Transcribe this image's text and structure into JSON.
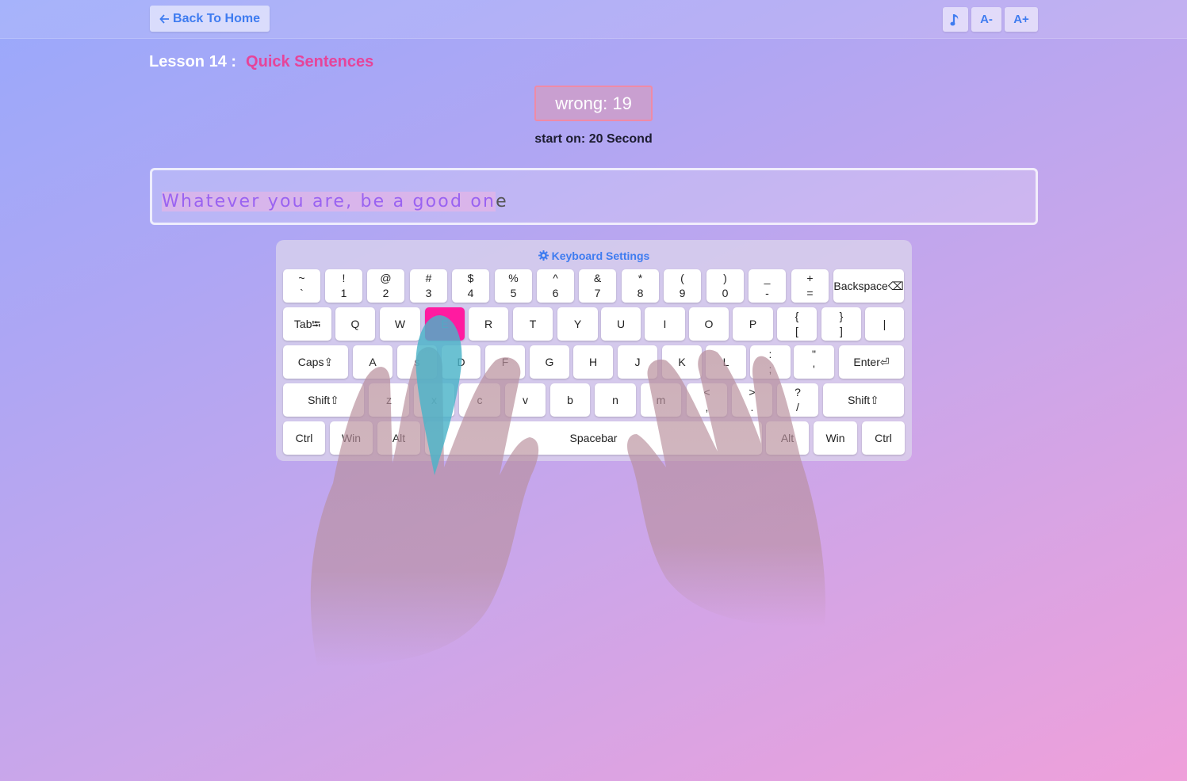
{
  "header": {
    "back_label": "Back To Home",
    "music_icon": "music-note-icon",
    "font_decrease_label": "A-",
    "font_increase_label": "A+"
  },
  "lesson": {
    "number_label": "Lesson 14 :",
    "title": "Quick Sentences"
  },
  "stats": {
    "wrong_label": "wrong: 19",
    "start_label": "start on: 20 Second"
  },
  "typing": {
    "typed": "Whatever you are, be a good on",
    "remaining": "e"
  },
  "keyboard": {
    "settings_label": "Keyboard Settings",
    "active_key": "E",
    "rows": [
      [
        [
          "~",
          "`"
        ],
        [
          "!",
          "1"
        ],
        [
          "@",
          "2"
        ],
        [
          "#",
          "3"
        ],
        [
          "$",
          "4"
        ],
        [
          "%",
          "5"
        ],
        [
          "^",
          "6"
        ],
        [
          "&",
          "7"
        ],
        [
          "*",
          "8"
        ],
        [
          "(",
          "9"
        ],
        [
          ")",
          "0"
        ],
        [
          "_",
          "-"
        ],
        [
          "+",
          "="
        ],
        [
          "Backspace⌫"
        ]
      ],
      [
        [
          "Tab⭾"
        ],
        [
          "Q"
        ],
        [
          "W"
        ],
        [
          "E"
        ],
        [
          "R"
        ],
        [
          "T"
        ],
        [
          "Y"
        ],
        [
          "U"
        ],
        [
          "I"
        ],
        [
          "O"
        ],
        [
          "P"
        ],
        [
          "{",
          "["
        ],
        [
          "}",
          "]"
        ],
        [
          "|"
        ]
      ],
      [
        [
          "Caps⇪"
        ],
        [
          "A"
        ],
        [
          "s"
        ],
        [
          "D"
        ],
        [
          "F"
        ],
        [
          "G"
        ],
        [
          "H"
        ],
        [
          "J"
        ],
        [
          "K"
        ],
        [
          "L"
        ],
        [
          ":",
          ";"
        ],
        [
          "\"",
          "'"
        ],
        [
          "Enter⏎"
        ]
      ],
      [
        [
          "Shift⇧"
        ],
        [
          "z"
        ],
        [
          "x"
        ],
        [
          "c"
        ],
        [
          "v"
        ],
        [
          "b"
        ],
        [
          "n"
        ],
        [
          "m"
        ],
        [
          "<",
          ","
        ],
        [
          ">",
          "."
        ],
        [
          "?",
          "/"
        ],
        [
          "Shift⇧"
        ]
      ],
      [
        [
          "Ctrl"
        ],
        [
          "Win"
        ],
        [
          "Alt"
        ],
        [
          "Spacebar"
        ],
        [
          "Alt"
        ],
        [
          "Win"
        ],
        [
          "Ctrl"
        ]
      ]
    ]
  },
  "colors": {
    "accent": "#3f7cf0",
    "lesson_title": "#e6449a",
    "active_key": "#ff1ba0",
    "typed_text": "#9a63f1"
  }
}
